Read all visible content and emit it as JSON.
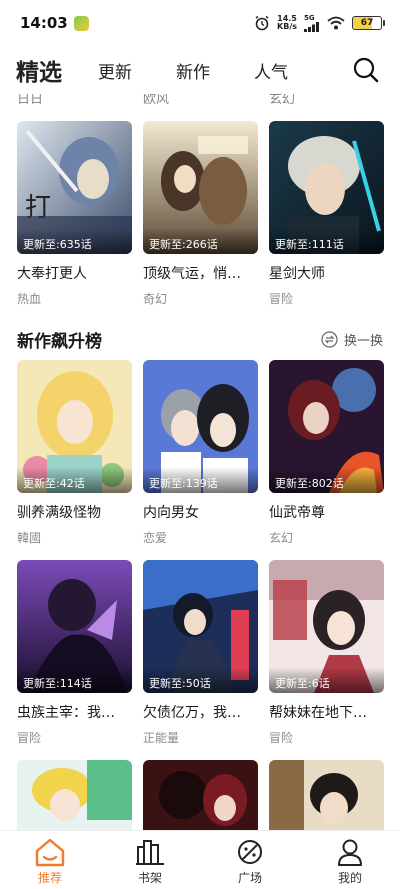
{
  "status_bar": {
    "time": "14:03",
    "speed_value": "14.5",
    "speed_unit": "KB/s",
    "network": "5G",
    "battery": "67"
  },
  "top_nav": {
    "tabs": [
      {
        "label": "精选",
        "active": true
      },
      {
        "label": "更新",
        "active": false
      },
      {
        "label": "新作",
        "active": false
      },
      {
        "label": "人气",
        "active": false
      }
    ]
  },
  "partial_row": [
    "日日",
    "欧风",
    "玄幻"
  ],
  "section1": {
    "items": [
      {
        "title": "大奉打更人",
        "genre": "热血",
        "update": "更新至:635话"
      },
      {
        "title": "顶级气运，悄…",
        "genre": "奇幻",
        "update": "更新至:266话"
      },
      {
        "title": "星剑大师",
        "genre": "冒险",
        "update": "更新至:111话"
      }
    ]
  },
  "section2": {
    "title": "新作飙升榜",
    "refresh_label": "换一换",
    "items": [
      {
        "title": "驯养满级怪物",
        "genre": "韓國",
        "update": "更新至:42话"
      },
      {
        "title": "内向男女",
        "genre": "恋爱",
        "update": "更新至:139话"
      },
      {
        "title": "仙武帝尊",
        "genre": "玄幻",
        "update": "更新至:802话"
      },
      {
        "title": "虫族主宰：我…",
        "genre": "冒险",
        "update": "更新至:114话"
      },
      {
        "title": "欠债亿万，我…",
        "genre": "正能量",
        "update": "更新至:50话"
      },
      {
        "title": "帮妹妹在地下…",
        "genre": "冒险",
        "update": "更新至:6话"
      }
    ]
  },
  "bottom_nav": {
    "items": [
      {
        "label": "推荐",
        "active": true
      },
      {
        "label": "书架",
        "active": false
      },
      {
        "label": "广场",
        "active": false
      },
      {
        "label": "我的",
        "active": false
      }
    ]
  },
  "colors": {
    "accent": "#f07a2e",
    "text_primary": "#1a1a1a",
    "text_secondary": "#8a8a8a"
  }
}
